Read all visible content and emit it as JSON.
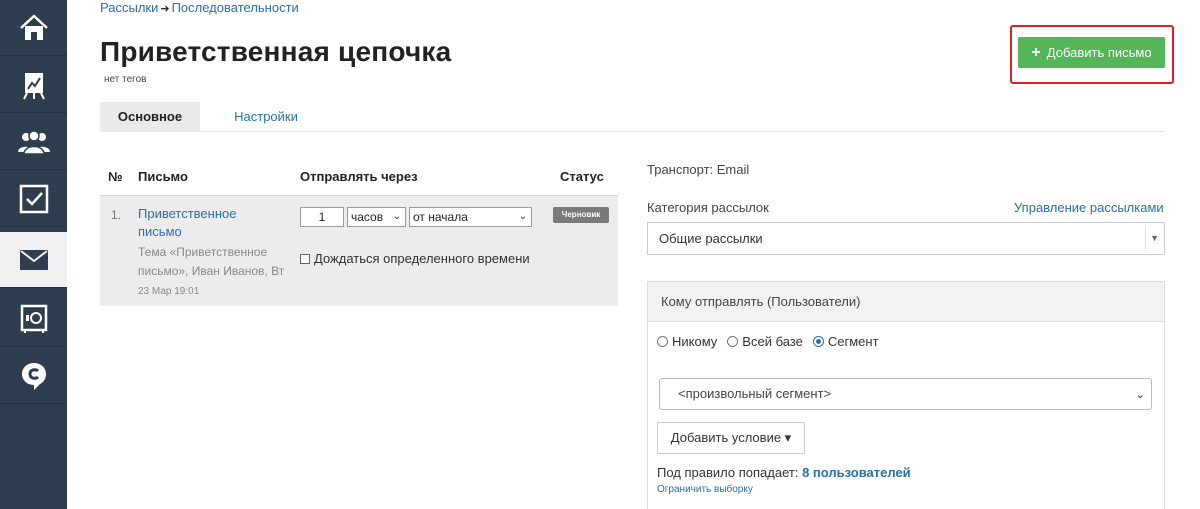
{
  "sidebar": {
    "items": [
      {
        "icon": "home-icon",
        "active": false
      },
      {
        "icon": "stats-icon",
        "active": false
      },
      {
        "icon": "users-icon",
        "active": false
      },
      {
        "icon": "tasks-icon",
        "active": false
      },
      {
        "icon": "mail-icon",
        "active": true
      },
      {
        "icon": "safe-icon",
        "active": false
      },
      {
        "icon": "chat-icon",
        "active": false
      }
    ]
  },
  "breadcrumb": {
    "root": "Рассылки",
    "separator": "➜",
    "current": "Последовательности"
  },
  "page": {
    "title": "Приветственная цепочка",
    "tags": "нет тегов"
  },
  "toolbar": {
    "add_letter_label": "Добавить письмо",
    "add_icon": "+"
  },
  "tabs": [
    {
      "label": "Основное",
      "active": true
    },
    {
      "label": "Настройки",
      "active": false
    }
  ],
  "table": {
    "headers": {
      "num": "№",
      "letter": "Письмо",
      "send_after": "Отправлять через",
      "status": "Статус"
    },
    "rows": [
      {
        "num": "1.",
        "title": "Приветственное письмо",
        "meta": "Тема «Приветственное письмо», Иван Иванов, Вт",
        "date": "23 Мар 19:01",
        "delay_value": "1",
        "delay_unit": "часов",
        "delay_from": "от начала",
        "wait_label": "Дождаться определенного времени",
        "status": "Черновик"
      }
    ]
  },
  "settings": {
    "transport": "Транспорт: Email",
    "category_label": "Категория рассылок",
    "manage_link": "Управление рассылками",
    "category_value": "Общие рассылки",
    "audience_title": "Кому отправлять (Пользователи)",
    "radios": [
      {
        "label": "Никому",
        "checked": false
      },
      {
        "label": "Всей базе",
        "checked": false
      },
      {
        "label": "Сегмент",
        "checked": true
      }
    ],
    "segment_value": "<произвольный сегмент>",
    "add_condition_label": "Добавить условие ▾",
    "rule_prefix": "Под правило попадает:",
    "rule_count": "8 пользователей",
    "limit_link": "Ограничить выборку"
  },
  "colors": {
    "sidebar": "#2f3e4f",
    "link": "#2b6fa8",
    "add_button": "#55b559",
    "highlight": "#e02020",
    "badge": "#7a7a7a"
  }
}
